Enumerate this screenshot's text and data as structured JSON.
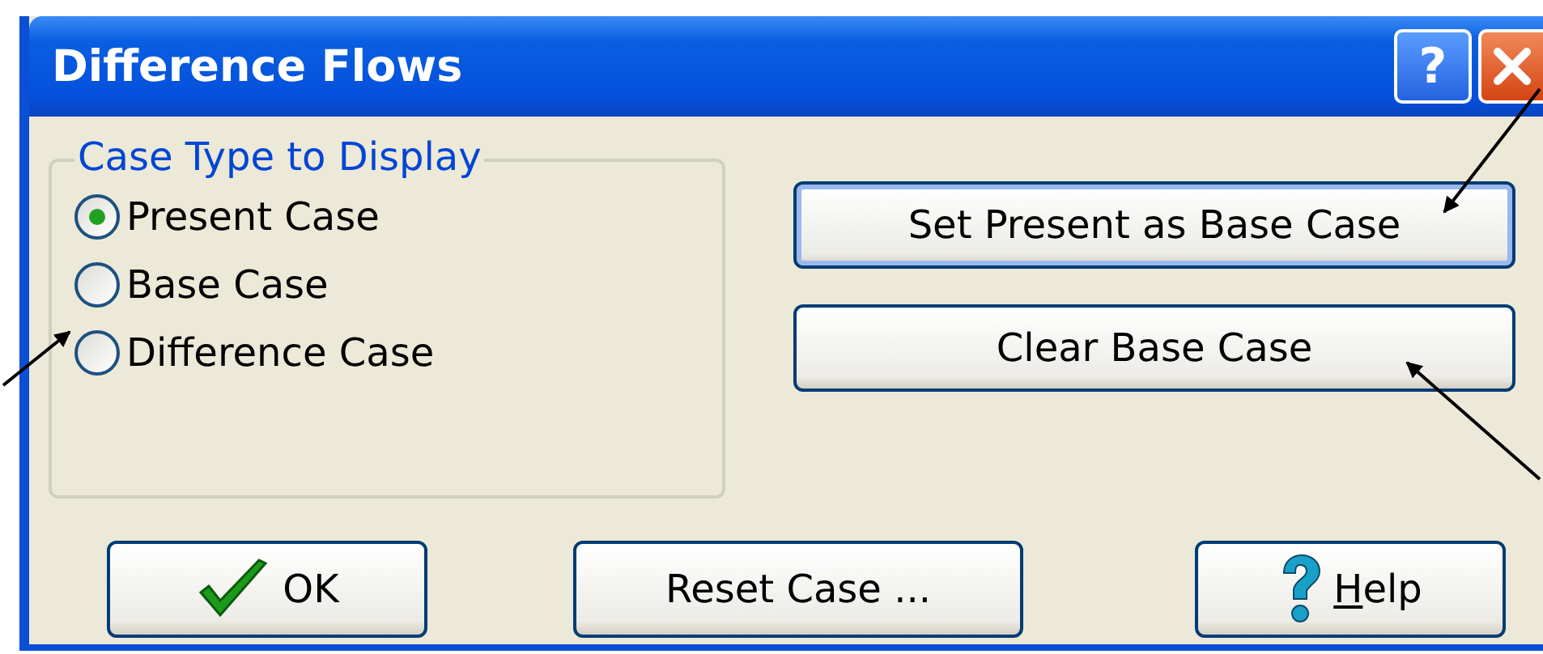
{
  "window": {
    "title": "Difference Flows",
    "help_button": "?"
  },
  "case_group": {
    "title": "Case Type to Display",
    "options": [
      {
        "label": "Present Case",
        "selected": true
      },
      {
        "label": "Base Case",
        "selected": false
      },
      {
        "label": "Difference Case",
        "selected": false
      }
    ]
  },
  "action_buttons": [
    "Set Present as Base Case",
    "Clear Base Case"
  ],
  "bottom_buttons": [
    {
      "label": "OK",
      "kind": "ok"
    },
    {
      "label": "Reset Case ...",
      "kind": "plain"
    },
    {
      "label": "Help",
      "kind": "help"
    }
  ]
}
